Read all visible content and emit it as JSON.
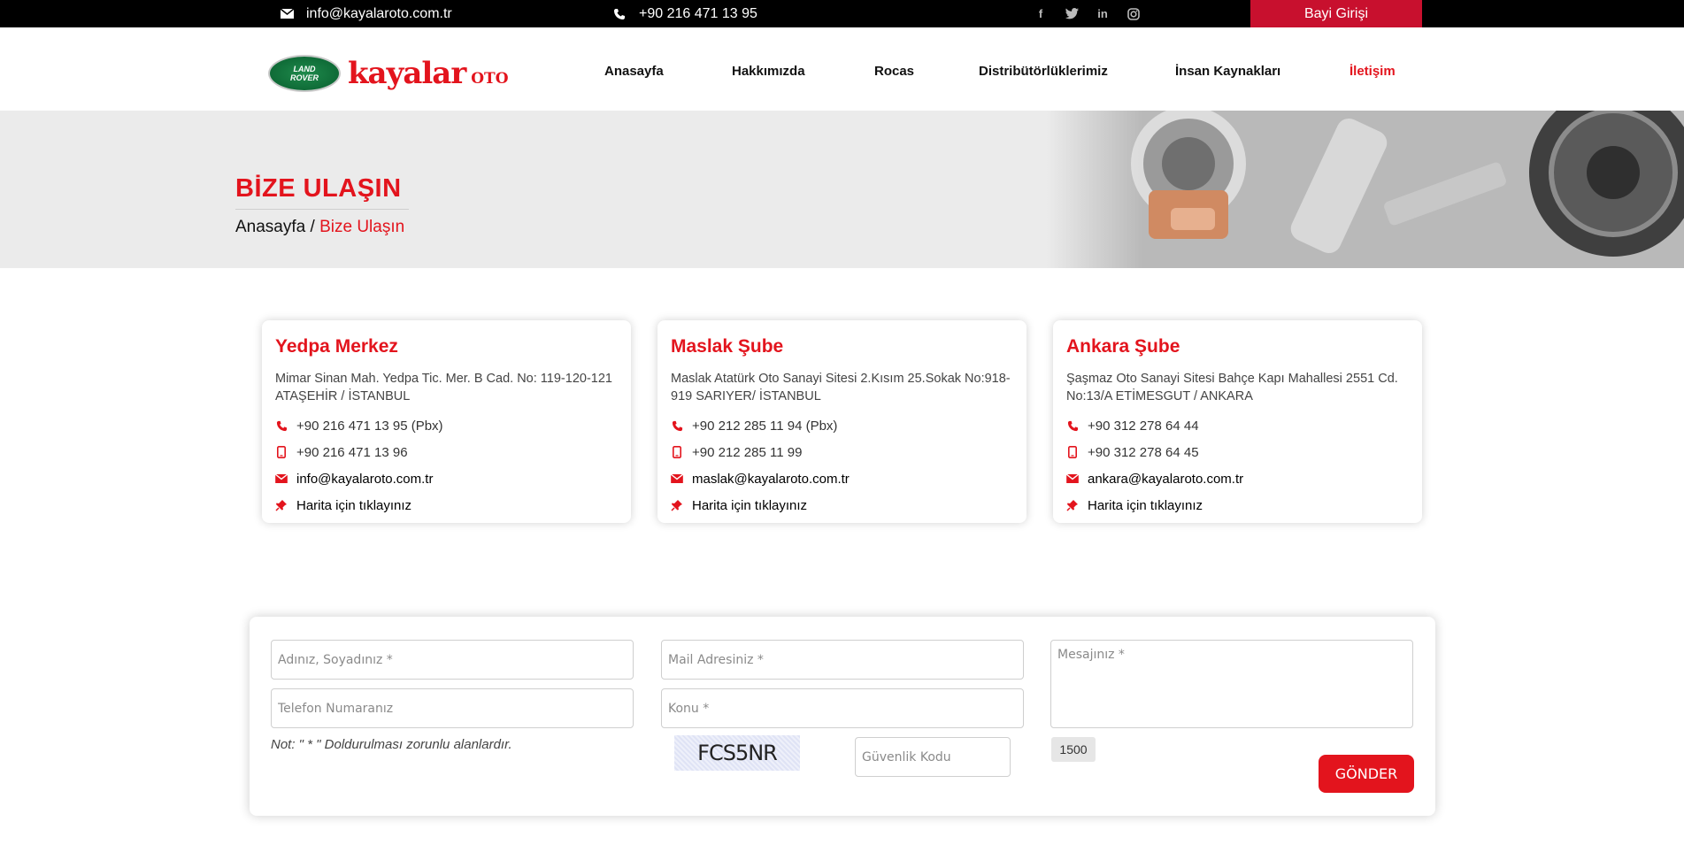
{
  "topbar": {
    "email": "info@kayalaroto.com.tr",
    "phone": "+90 216 471 13 95",
    "social": [
      "f",
      "t",
      "in",
      "ig"
    ],
    "dealer_login": "Bayi Girişi"
  },
  "header": {
    "logo_badge_line1": "LAND",
    "logo_badge_line2": "ROVER",
    "brand": "kayalar",
    "brand_suffix": "OTO",
    "nav": [
      "Anasayfa",
      "Hakkımızda",
      "Rocas",
      "Distribütörlüklerimiz",
      "İnsan Kaynakları",
      "İletişim"
    ]
  },
  "banner": {
    "title": "BİZE ULAŞIN",
    "breadcrumb_home": "Anasayfa",
    "breadcrumb_sep": "/",
    "breadcrumb_current": "Bize Ulaşın"
  },
  "branches": [
    {
      "name": "Yedpa Merkez",
      "address": "Mimar Sinan Mah. Yedpa Tic. Mer. B Cad. No: 119-120-121 ATAŞEHİR / İSTANBUL",
      "phone": "+90 216 471 13 95 (Pbx)",
      "mobile": "+90 216 471 13 96",
      "email": "info@kayalaroto.com.tr",
      "map": "Harita için tıklayınız"
    },
    {
      "name": "Maslak Şube",
      "address": "Maslak Atatürk Oto Sanayi Sitesi 2.Kısım 25.Sokak No:918-919 SARIYER/ İSTANBUL",
      "phone": "+90 212 285 11 94 (Pbx)",
      "mobile": "+90 212 285 11 99",
      "email": "maslak@kayalaroto.com.tr",
      "map": "Harita için tıklayınız"
    },
    {
      "name": "Ankara Şube",
      "address": "Şaşmaz Oto Sanayi Sitesi Bahçe Kapı Mahallesi 2551 Cd. No:13/A ETİMESGUT / ANKARA",
      "phone": "+90 312 278 64 44",
      "mobile": "+90 312 278 64 45",
      "email": "ankara@kayalaroto.com.tr",
      "map": "Harita için tıklayınız"
    }
  ],
  "form": {
    "name_placeholder": "Adınız, Soyadınız *",
    "email_placeholder": "Mail Adresiniz *",
    "message_placeholder": "Mesajınız *",
    "phone_placeholder": "Telefon Numaranız",
    "subject_placeholder": "Konu *",
    "note": "Not: \" * \" Doldurulması zorunlu alanlardır.",
    "captcha_text": "FCS5NR",
    "security_placeholder": "Güvenlik Kodu",
    "char_counter": "1500",
    "submit_label": "GÖNDER"
  },
  "colors": {
    "accent": "#e3141d",
    "topbar": "#000000",
    "dealer": "#c8102e"
  }
}
